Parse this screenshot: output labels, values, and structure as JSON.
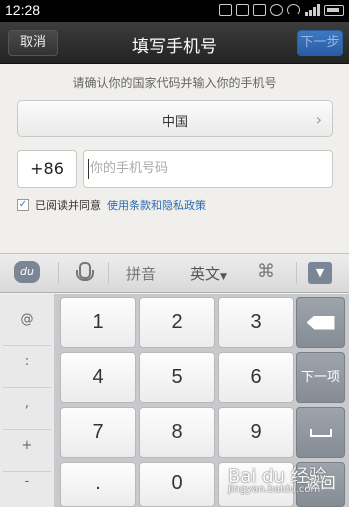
{
  "status_bar": {
    "time": "12:28",
    "icons": [
      "scan-icon",
      "sms-icon",
      "chat-icon",
      "alarm-icon",
      "wifi-icon",
      "signal-icon",
      "battery-icon"
    ]
  },
  "header": {
    "cancel_label": "取消",
    "title": "填写手机号",
    "next_label": "下一步"
  },
  "form": {
    "hint": "请确认你的国家代码并输入你的手机号",
    "country": "中国",
    "country_code": "+86",
    "phone_placeholder": "你的手机号码",
    "phone_value": "",
    "agree_checked": true,
    "agree_text": "已阅读并同意",
    "agree_link": "使用条款和隐私政策"
  },
  "keyboard_toolbar": {
    "logo": "du",
    "pinyin": "拼音",
    "english": "英文",
    "icons": [
      "baidu-logo-icon",
      "mic-icon",
      "grid-icon",
      "collapse-keyboard-icon"
    ]
  },
  "keyboard": {
    "side_keys": [
      "@",
      ":",
      ",",
      "+",
      "-"
    ],
    "rows": [
      [
        "1",
        "2",
        "3"
      ],
      [
        "4",
        "5",
        "6"
      ],
      [
        "7",
        "8",
        "9"
      ],
      [
        ".",
        "0",
        ""
      ]
    ],
    "next_key_label": "下一项",
    "bottom_right_label": "返回"
  },
  "watermark": {
    "text": "Bai du 经验",
    "sub": "jingyan.baidu.com"
  },
  "colors": {
    "accent": "#2a5ea3",
    "link": "#2a6bb5"
  }
}
